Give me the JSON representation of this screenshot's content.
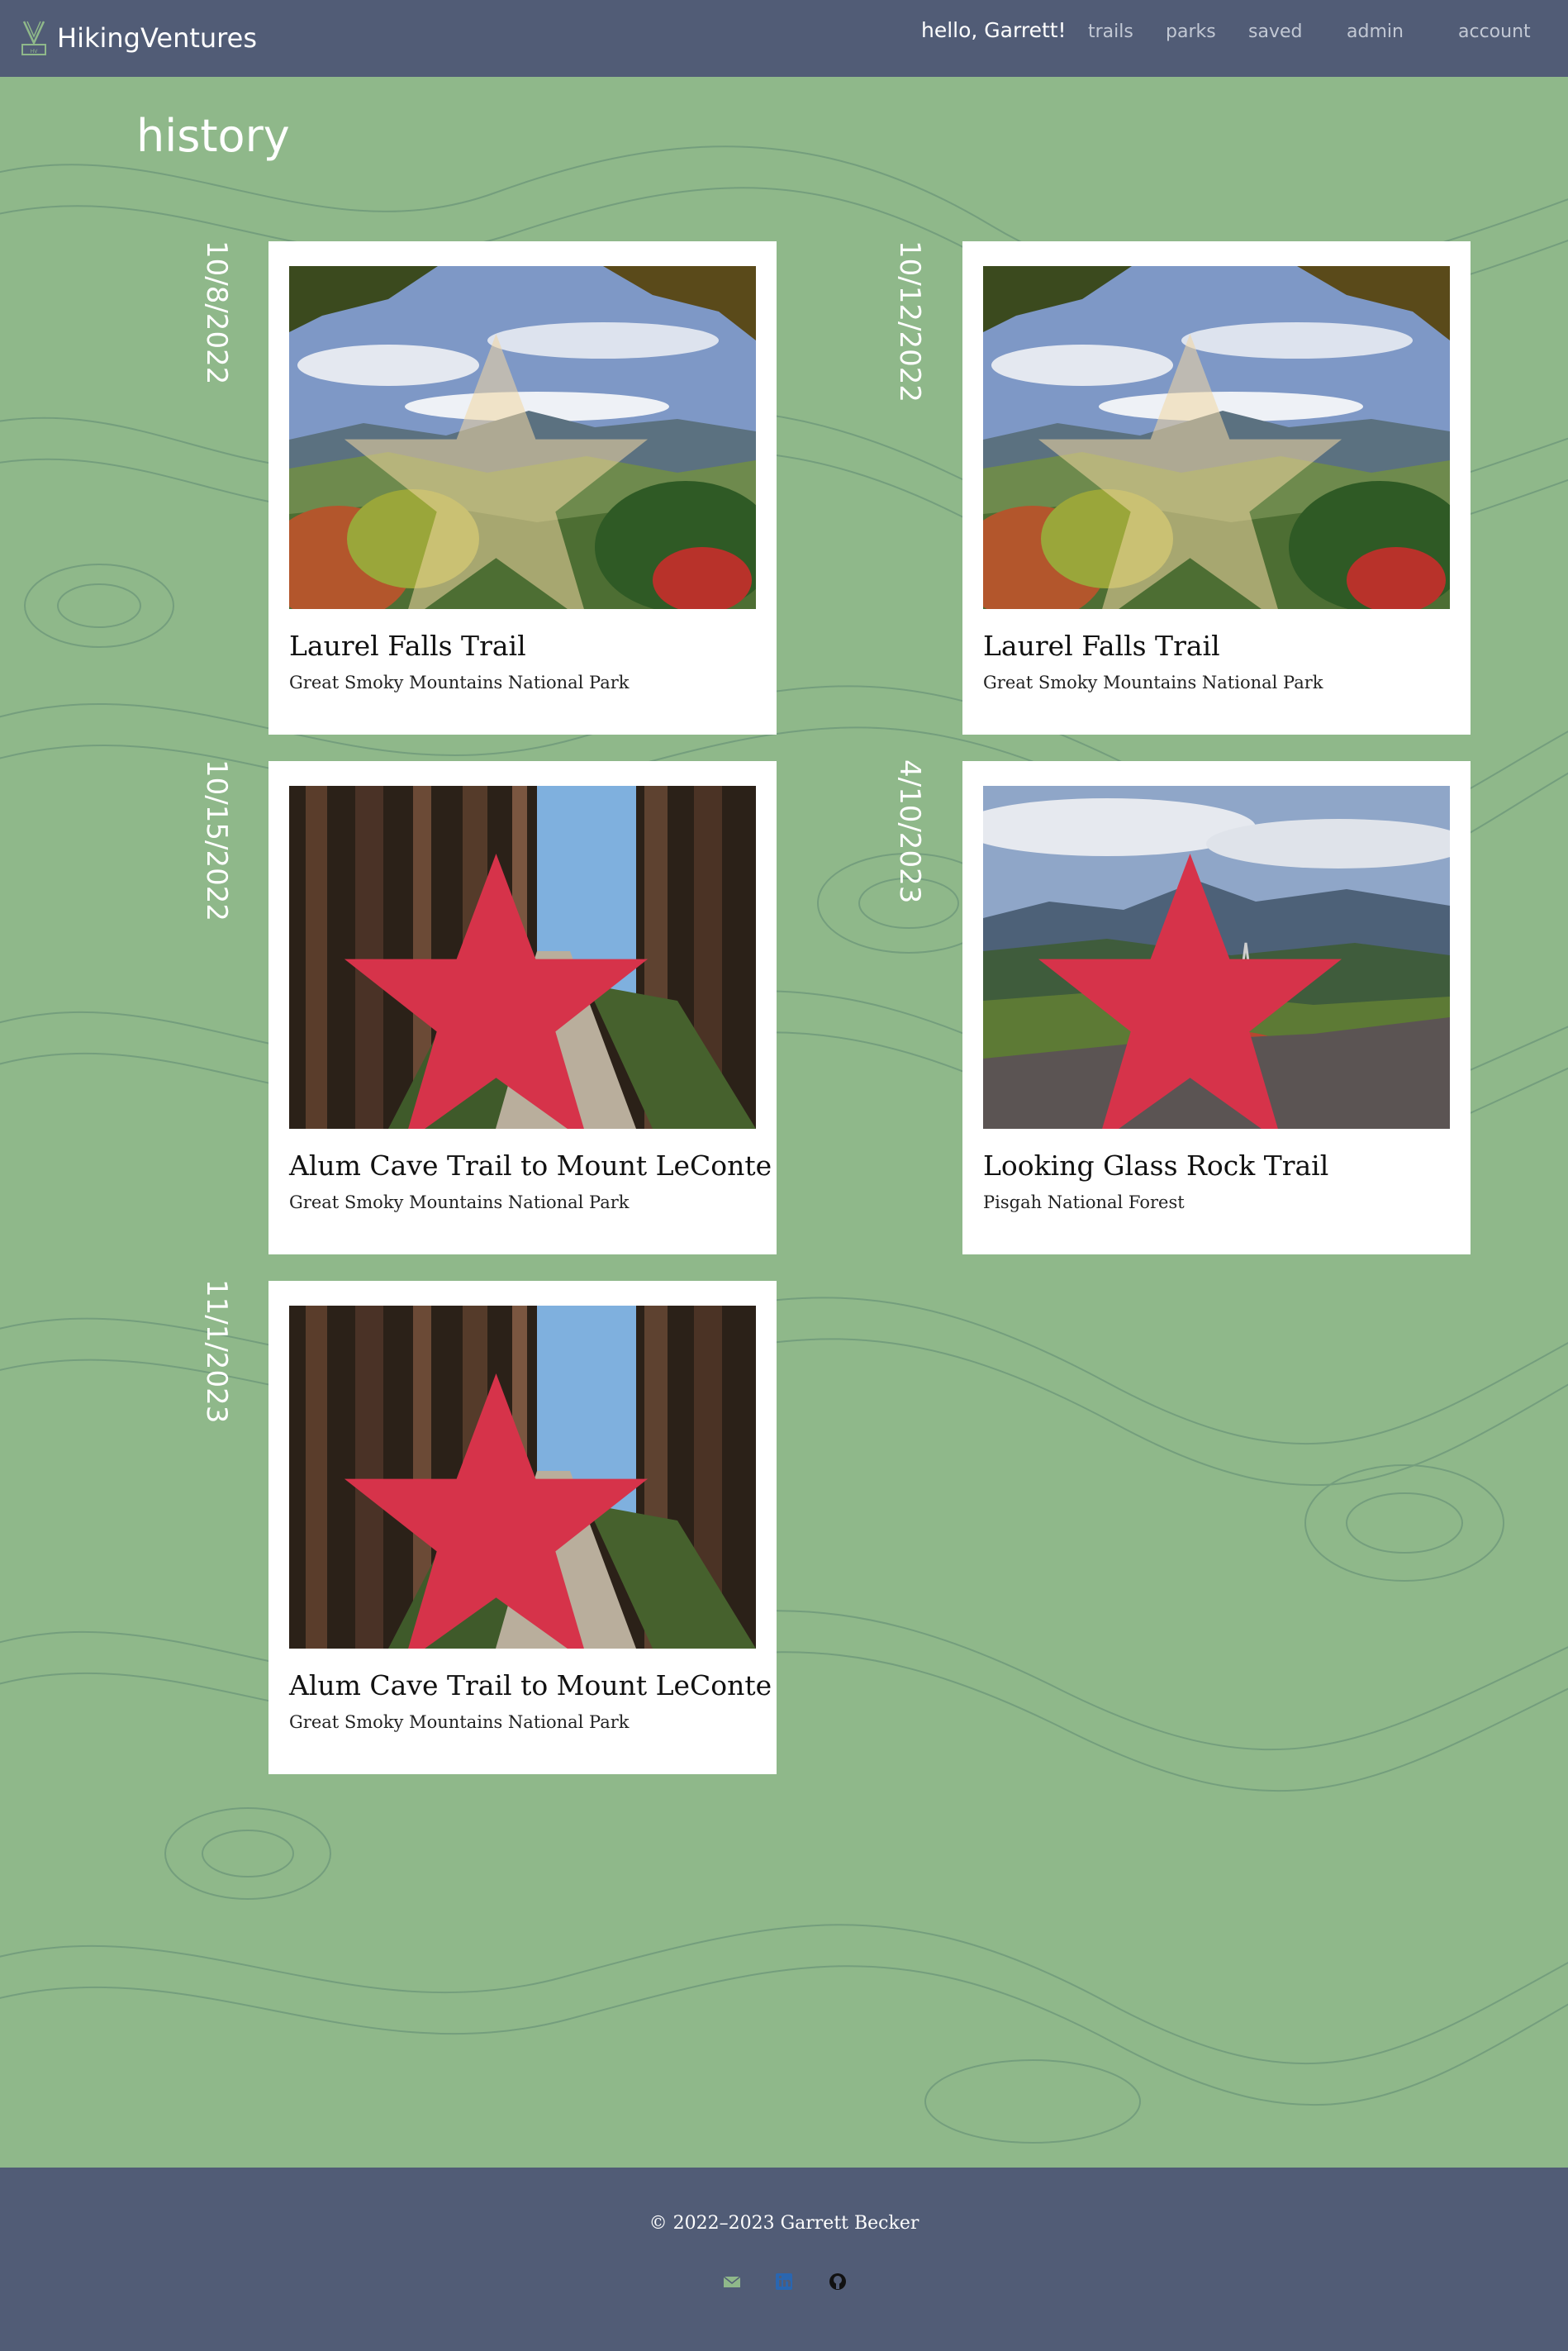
{
  "navbar": {
    "brand": "HikingVentures",
    "greeting": "hello, Garrett!",
    "links": [
      "trails",
      "parks",
      "saved",
      "admin",
      "account"
    ]
  },
  "page": {
    "title": "history"
  },
  "entries": [
    {
      "date": "10/8/2022",
      "title": "Laurel Falls Trail",
      "park": "Great Smoky Mountains National Park",
      "favorite": false,
      "photo": "autumn-mountain-vista"
    },
    {
      "date": "10/12/2022",
      "title": "Laurel Falls Trail",
      "park": "Great Smoky Mountains National Park",
      "favorite": false,
      "photo": "autumn-mountain-vista"
    },
    {
      "date": "10/15/2022",
      "title": "Alum Cave Trail to Mount LeConte",
      "park": "Great Smoky Mountains National Park",
      "favorite": true,
      "photo": "forest-trail"
    },
    {
      "date": "4/10/2023",
      "title": "Looking Glass Rock Trail",
      "park": "Pisgah National Forest",
      "favorite": true,
      "photo": "rock-overlook"
    },
    {
      "date": "11/1/2023",
      "title": "Alum Cave Trail to Mount LeConte",
      "park": "Great Smoky Mountains National Park",
      "favorite": true,
      "photo": "forest-trail"
    }
  ],
  "footer": {
    "copyright": "© 2022–2023 Garrett Becker",
    "icons": [
      "email-icon",
      "linkedin-icon",
      "github-icon"
    ]
  },
  "colors": {
    "nav_bg": "#515c76",
    "page_bg": "#8fb88a",
    "favorite_star": "#d6334a",
    "unfavorited_star": "#f2d7a2"
  }
}
